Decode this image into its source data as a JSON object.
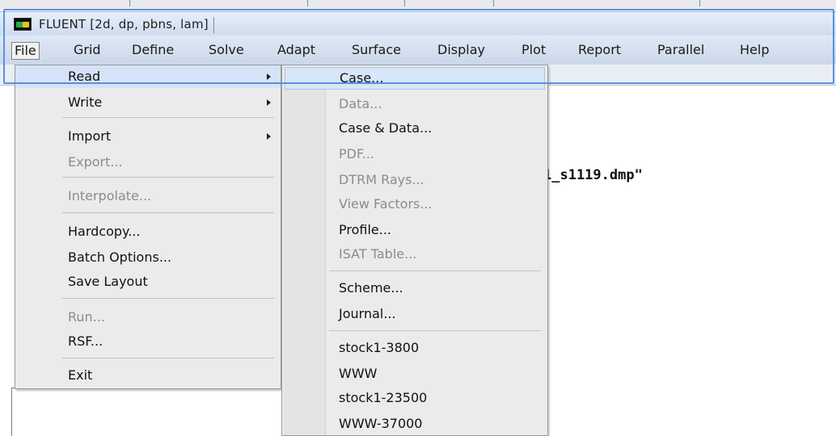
{
  "window": {
    "title": "FLUENT  [2d, dp, pbns, lam]",
    "icon": "fluent-app-icon"
  },
  "menubar": {
    "items": [
      "File",
      "Grid",
      "Define",
      "Solve",
      "Adapt",
      "Surface",
      "Display",
      "Plot",
      "Report",
      "Parallel",
      "Help"
    ],
    "active": "File"
  },
  "console": {
    "line": "1_s1119.dmp\""
  },
  "file_menu": {
    "items": [
      {
        "label": "Read",
        "submenu": true,
        "enabled": true,
        "highlighted": true
      },
      {
        "label": "Write",
        "submenu": true,
        "enabled": true
      },
      {
        "label": "Import",
        "submenu": true,
        "enabled": true
      },
      {
        "label": "Export...",
        "enabled": false
      },
      {
        "label": "Interpolate...",
        "enabled": false
      },
      {
        "label": "Hardcopy...",
        "enabled": true
      },
      {
        "label": "Batch Options...",
        "enabled": true
      },
      {
        "label": "Save Layout",
        "enabled": true
      },
      {
        "label": "Run...",
        "enabled": false
      },
      {
        "label": "RSF...",
        "enabled": true
      },
      {
        "label": "Exit",
        "enabled": true
      }
    ]
  },
  "read_submenu": {
    "items": [
      {
        "label": "Case...",
        "enabled": true,
        "highlighted": true
      },
      {
        "label": "Data...",
        "enabled": false
      },
      {
        "label": "Case & Data...",
        "enabled": true
      },
      {
        "label": "PDF...",
        "enabled": false
      },
      {
        "label": "DTRM Rays...",
        "enabled": false
      },
      {
        "label": "View Factors...",
        "enabled": false
      },
      {
        "label": "Profile...",
        "enabled": true
      },
      {
        "label": "ISAT Table...",
        "enabled": false
      },
      {
        "label": "Scheme...",
        "enabled": true
      },
      {
        "label": "Journal...",
        "enabled": true
      },
      {
        "label": "stock1-3800",
        "enabled": true
      },
      {
        "label": "WWW",
        "enabled": true
      },
      {
        "label": "stock1-23500",
        "enabled": true
      },
      {
        "label": "WWW-37000",
        "enabled": true
      }
    ]
  },
  "colors": {
    "selection_frame": "#5b8fe0",
    "menu_background": "#ebebeb",
    "disabled_text": "#8c8c8c",
    "hover": "#d4e3f7"
  }
}
